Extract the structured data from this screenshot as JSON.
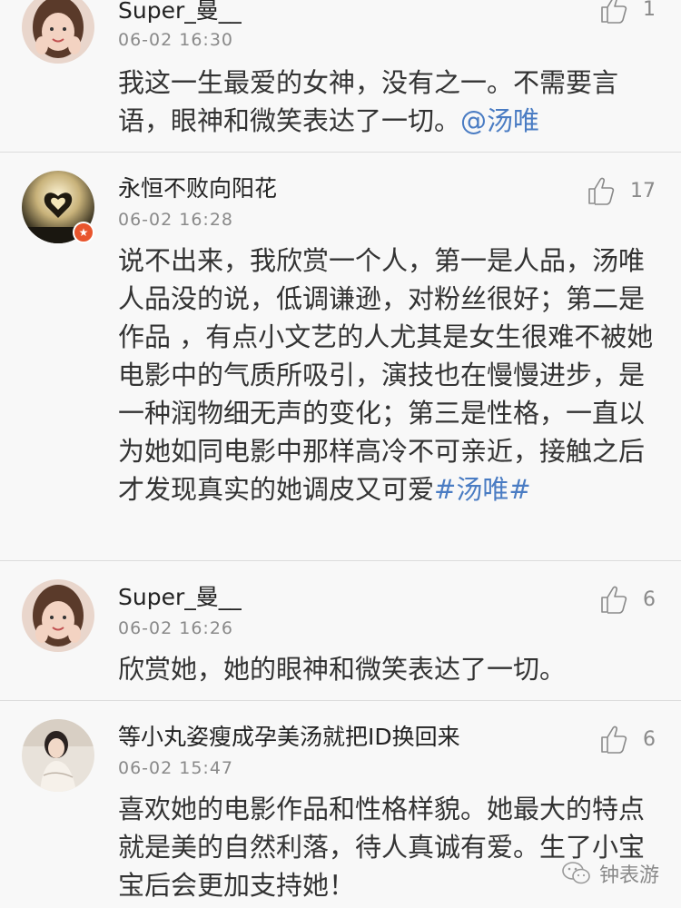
{
  "comments": [
    {
      "user": "Super_曼__",
      "time": "06-02 16:30",
      "likes": "1",
      "text": "我这一生最爱的女神，没有之一。不需要言语，眼神和微笑表达了一切。",
      "link": "@汤唯",
      "avatar_icon": "avatar-girl-icon",
      "verified": false
    },
    {
      "user": "永恒不败向阳花",
      "time": "06-02 16:28",
      "likes": "17",
      "text": "说不出来，我欣赏一个人，第一是人品，汤唯人品没的说，低调谦逊，对粉丝很好；第二是作品 ，有点小文艺的人尤其是女生很难不被她电影中的气质所吸引，演技也在慢慢进步，是一种润物细无声的变化；第三是性格，一直以为她如同电影中那样高冷不可亲近，接触之后才发现真实的她调皮又可爱",
      "link": "#汤唯#",
      "avatar_icon": "avatar-heart-hands-icon",
      "verified": true
    },
    {
      "user": "Super_曼__",
      "time": "06-02 16:26",
      "likes": "6",
      "text": "欣赏她，她的眼神和微笑表达了一切。",
      "link": "",
      "avatar_icon": "avatar-girl-icon",
      "verified": false
    },
    {
      "user": "等小丸姿瘦成孕美汤就把ID换回来",
      "time": "06-02 15:47",
      "likes": "6",
      "text": "喜欢她的电影作品和性格样貌。她最大的特点就是美的自然利落，待人真诚有爱。生了小宝宝后会更加支持她！",
      "link": "",
      "avatar_icon": "avatar-woman-icon",
      "verified": false
    }
  ],
  "watermark": {
    "text": "钟表游",
    "icon": "wechat-icon"
  },
  "colors": {
    "link": "#4a7cc3",
    "meta": "#8a8a8a",
    "badge": "#e8552d",
    "background": "#f8f8f8"
  }
}
